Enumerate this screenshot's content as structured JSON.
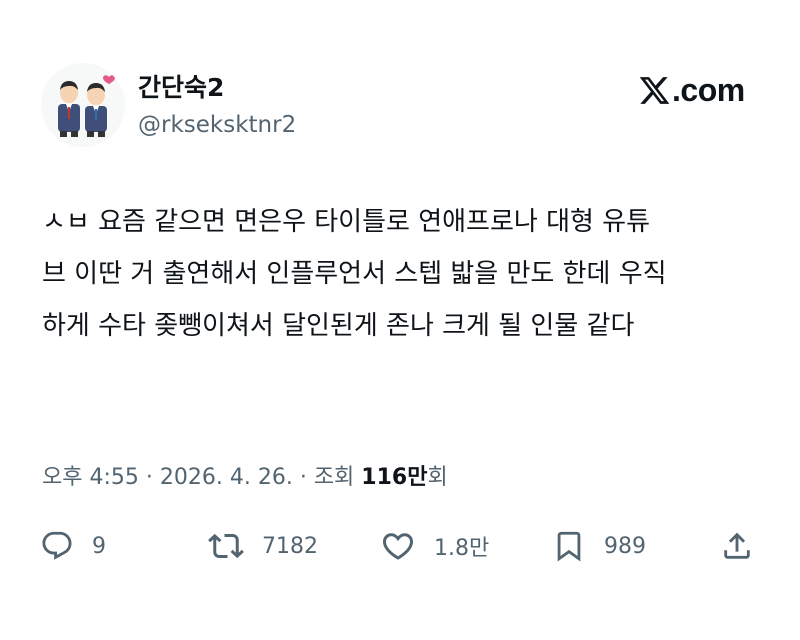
{
  "author": {
    "name": "간단숙2",
    "handle": "@rkseksktnr2",
    "avatar_icon": "cartoon-couple-avatar"
  },
  "brand": {
    "icon": "x-logo-icon",
    "label": ".com"
  },
  "tweet": {
    "lines": [
      "ㅅㅂ 요즘 같으면 면은우 타이틀로 연애프로나 대형 유튜",
      "브 이딴 거 출연해서 인플루언서 스텝 밟을 만도 한데 우직",
      "하게 수타 좆뺑이쳐서 달인된게 존나 크게 될 인물 같다"
    ]
  },
  "meta": {
    "time": "오후 4:55",
    "sep1": " · ",
    "date": "2026. 4. 26.",
    "sep2": " · ",
    "views_prefix": "조회 ",
    "views_count": "116만",
    "views_suffix": "회"
  },
  "actions": {
    "replies": "9",
    "retweets": "7182",
    "likes": "1.8만",
    "bookmarks": "989"
  },
  "colors": {
    "text": "#0f1419",
    "secondary": "#536471",
    "background": "#ffffff"
  }
}
